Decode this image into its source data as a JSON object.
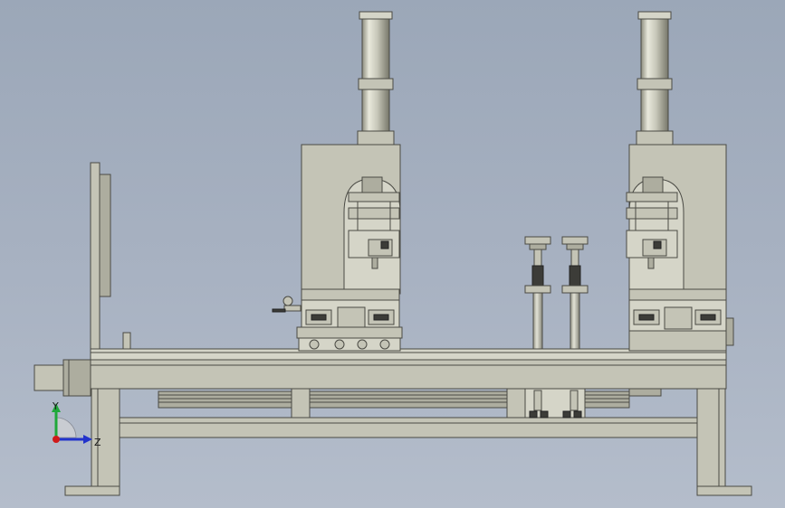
{
  "triad": {
    "y_label": "Y",
    "z_label": "Z",
    "colors": {
      "y": "#1fa83a",
      "z": "#2233cc",
      "x": "#d01a1a"
    }
  }
}
